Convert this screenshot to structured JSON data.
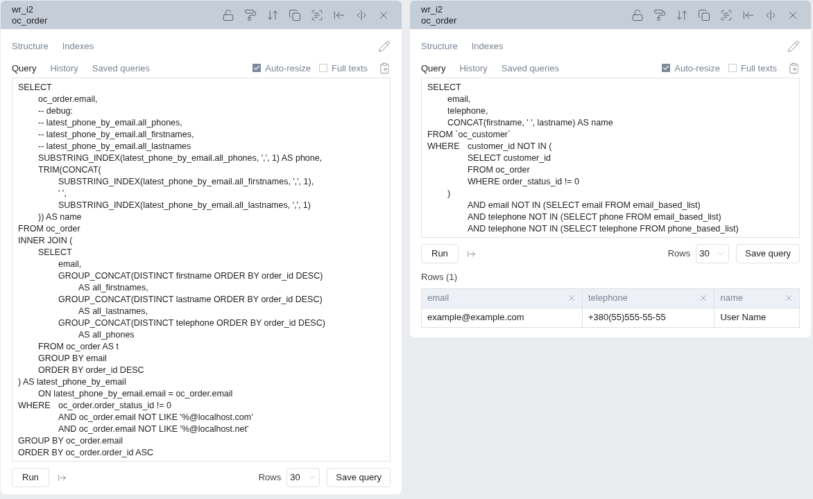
{
  "panels": [
    {
      "header": {
        "database": "wr_i2",
        "table": "oc_order"
      },
      "top_tabs": [
        {
          "label": "Structure",
          "selected": false
        },
        {
          "label": "Indexes",
          "selected": false
        }
      ],
      "query_tabs": [
        {
          "label": "Query",
          "selected": true
        },
        {
          "label": "History",
          "selected": false
        },
        {
          "label": "Saved queries",
          "selected": false
        }
      ],
      "options": [
        {
          "label": "Auto-resize",
          "checked": true
        },
        {
          "label": "Full texts",
          "checked": false
        }
      ],
      "query": "SELECT\n\toc_order.email,\n\t-- debug:\n\t-- latest_phone_by_email.all_phones,\n\t-- latest_phone_by_email.all_firstnames,\n\t-- latest_phone_by_email.all_lastnames\n\tSUBSTRING_INDEX(latest_phone_by_email.all_phones, ',', 1) AS phone,\n\tTRIM(CONCAT(\n\t\tSUBSTRING_INDEX(latest_phone_by_email.all_firstnames, ',', 1),\n\t\t' ',\n\t\tSUBSTRING_INDEX(latest_phone_by_email.all_lastnames, ',', 1)\n\t)) AS name\nFROM oc_order\nINNER JOIN (\n\tSELECT\n\t\temail,\n\t\tGROUP_CONCAT(DISTINCT firstname ORDER BY order_id DESC)\n\t\t\tAS all_firstnames,\n\t\tGROUP_CONCAT(DISTINCT lastname ORDER BY order_id DESC)\n\t\t\tAS all_lastnames,\n\t\tGROUP_CONCAT(DISTINCT telephone ORDER BY order_id DESC)\n\t\t\tAS all_phones\n\tFROM oc_order AS t\n\tGROUP BY email\n\tORDER BY order_id DESC\n) AS latest_phone_by_email\n\tON latest_phone_by_email.email = oc_order.email\nWHERE\toc_order.order_status_id != 0\n\t\tAND oc_order.email NOT LIKE '%@localhost.com'\n\t\tAND oc_order.email NOT LIKE '%@localhost.net'\nGROUP BY oc_order.email\nORDER BY oc_order.order_id ASC",
      "run_label": "Run",
      "rows_label": "Rows",
      "rows_value": "30",
      "save_label": "Save query"
    },
    {
      "header": {
        "database": "wr_i2",
        "table": "oc_order"
      },
      "top_tabs": [
        {
          "label": "Structure",
          "selected": false
        },
        {
          "label": "Indexes",
          "selected": false
        }
      ],
      "query_tabs": [
        {
          "label": "Query",
          "selected": true
        },
        {
          "label": "History",
          "selected": false
        },
        {
          "label": "Saved queries",
          "selected": false
        }
      ],
      "options": [
        {
          "label": "Auto-resize",
          "checked": true
        },
        {
          "label": "Full texts",
          "checked": false
        }
      ],
      "query": "SELECT\n\temail,\n\ttelephone,\n\tCONCAT(firstname, ' ', lastname) AS name\nFROM `oc_customer`\nWHERE\tcustomer_id NOT IN (\n\t\tSELECT customer_id\n\t\tFROM oc_order\n\t\tWHERE order_status_id != 0\n\t)\n\t\tAND email NOT IN (SELECT email FROM email_based_list)\n\t\tAND telephone NOT IN (SELECT phone FROM email_based_list)\n\t\tAND telephone NOT IN (SELECT telephone FROM phone_based_list)",
      "run_label": "Run",
      "rows_label": "Rows",
      "rows_value": "30",
      "save_label": "Save query",
      "results": {
        "title": "Rows (1)",
        "columns": [
          "email",
          "telephone",
          "name"
        ],
        "rows": [
          [
            "example@example.com",
            "+380(55)555-55-55",
            "User Name"
          ]
        ]
      }
    }
  ]
}
